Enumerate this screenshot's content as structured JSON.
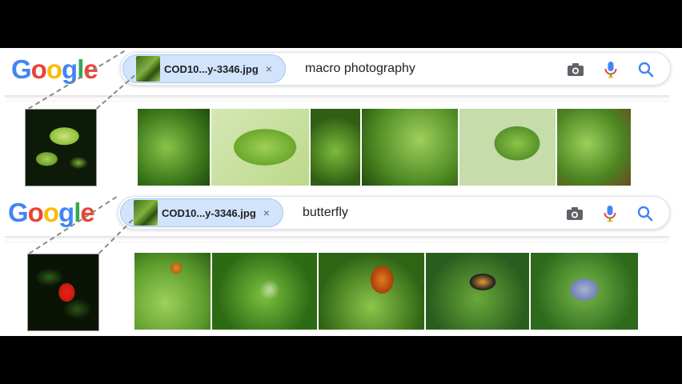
{
  "colors": {
    "chip_bg": "#d2e3fc",
    "mic_red": "#ea4335",
    "search_blue": "#4285f4",
    "letterbox": "#000000"
  },
  "searches": [
    {
      "logo": {
        "l1": "G",
        "l2": "o",
        "l3": "o",
        "l4": "g",
        "l5": "l",
        "l6": "e"
      },
      "chip": {
        "filename": "COD10...y-3346.jpg",
        "remove_glyph": "×"
      },
      "query": "macro photography",
      "icons": [
        "camera-icon",
        "microphone-icon",
        "search-icon"
      ],
      "source_thumb": "leaf-branch-photo",
      "results": [
        "leaf-cluster",
        "single-large-leaf",
        "leaf-closeup",
        "leaf-branch",
        "leaves-pale-background",
        "leaves-brown-stem"
      ]
    },
    {
      "logo": {
        "l1": "G",
        "l2": "o",
        "l3": "o",
        "l4": "g",
        "l5": "l",
        "l6": "e"
      },
      "chip": {
        "filename": "COD10...y-3346.jpg",
        "remove_glyph": "×"
      },
      "query": "butterfly",
      "icons": [
        "camera-icon",
        "microphone-icon",
        "search-icon"
      ],
      "source_thumb": "red-butterfly-on-leaves",
      "results": [
        "orange-butterfly-flying",
        "glasswing-butterfly",
        "monarch-on-flowers",
        "tiger-butterfly-on-flower",
        "blue-butterfly-on-leaf"
      ]
    }
  ]
}
